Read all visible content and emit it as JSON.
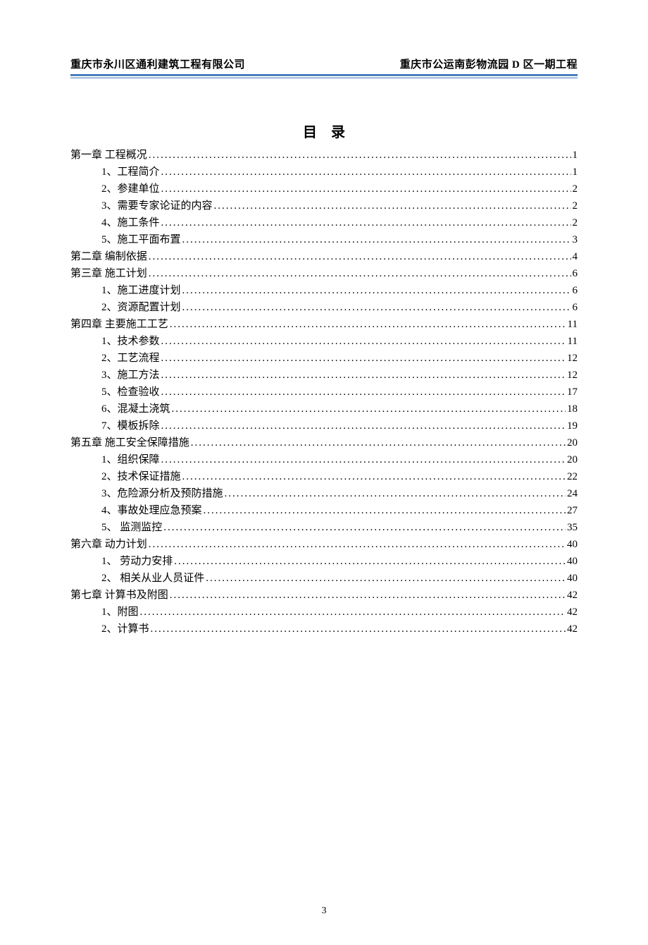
{
  "header": {
    "left": "重庆市永川区通利建筑工程有限公司",
    "right": "重庆市公运南彭物流园 D 区一期工程"
  },
  "toc": {
    "title": "目录",
    "entries": [
      {
        "level": 1,
        "label": "第一章   工程概况",
        "page": "1"
      },
      {
        "level": 2,
        "label": "1、工程简介",
        "page": "1"
      },
      {
        "level": 2,
        "label": "2、参建单位",
        "page": "2"
      },
      {
        "level": 2,
        "label": "3、需要专家论证的内容",
        "page": "2"
      },
      {
        "level": 2,
        "label": "4、施工条件",
        "page": "2"
      },
      {
        "level": 2,
        "label": "5、施工平面布置",
        "page": "3"
      },
      {
        "level": 1,
        "label": "第二章   编制依据",
        "page": "4"
      },
      {
        "level": 1,
        "label": "第三章   施工计划",
        "page": "6"
      },
      {
        "level": 2,
        "label": "1、施工进度计划",
        "page": "6"
      },
      {
        "level": 2,
        "label": "2、资源配置计划",
        "page": "6"
      },
      {
        "level": 1,
        "label": "第四章 主要施工工艺",
        "page": "11"
      },
      {
        "level": 2,
        "label": "1、技术参数",
        "page": "11"
      },
      {
        "level": 2,
        "label": "2、工艺流程",
        "page": "12"
      },
      {
        "level": 2,
        "label": "3、施工方法",
        "page": "12"
      },
      {
        "level": 2,
        "label": "5、检查验收",
        "page": "17"
      },
      {
        "level": 2,
        "label": "6、混凝土浇筑",
        "page": "18"
      },
      {
        "level": 2,
        "label": "7、模板拆除",
        "page": "19"
      },
      {
        "level": 1,
        "label": "第五章 施工安全保障措施",
        "page": "20"
      },
      {
        "level": 2,
        "label": "1、组织保障",
        "page": "20"
      },
      {
        "level": 2,
        "label": "2、技术保证措施",
        "page": "22"
      },
      {
        "level": 2,
        "label": "3、危险源分析及预防措施",
        "page": "24"
      },
      {
        "level": 2,
        "label": "4、事故处理应急预案",
        "page": "27"
      },
      {
        "level": 2,
        "label": "5、 监测监控",
        "page": "35"
      },
      {
        "level": 1,
        "label": "第六章    动力计划",
        "page": "40"
      },
      {
        "level": 2,
        "label": "1、 劳动力安排",
        "page": "40"
      },
      {
        "level": 2,
        "label": "2、  相关从业人员证件",
        "page": "40"
      },
      {
        "level": 1,
        "label": "第七章   计算书及附图",
        "page": "42"
      },
      {
        "level": 2,
        "label": "1、附图",
        "page": "42"
      },
      {
        "level": 2,
        "label": "2、计算书",
        "page": "42"
      }
    ]
  },
  "footer": {
    "page_number": "3"
  }
}
